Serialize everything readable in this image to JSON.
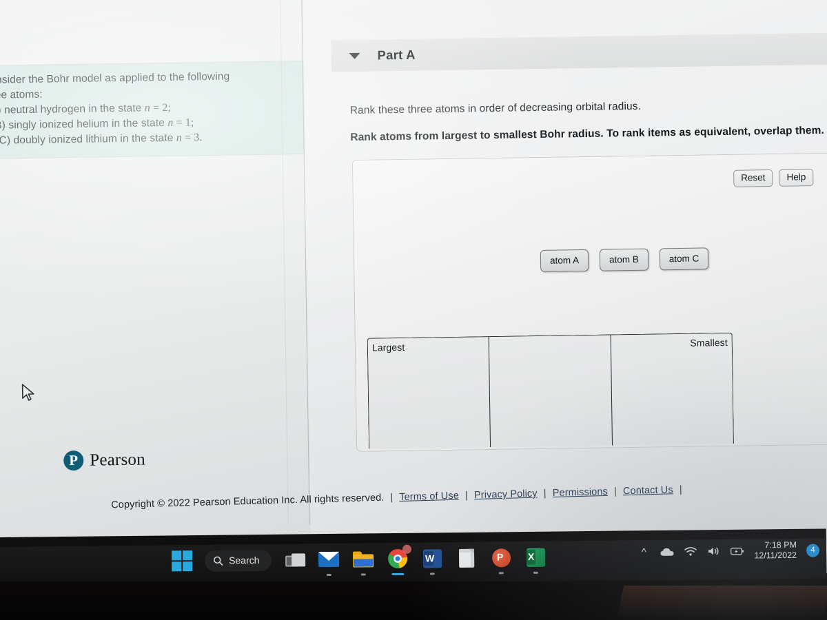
{
  "problem": {
    "line1": "Consider the Bohr model as applied to the following",
    "line2": "three atoms:",
    "itemA_pre": "(A) neutral hydrogen in the state ",
    "itemA_var": "n",
    "itemA_eq": " = ",
    "itemA_val": "2;",
    "itemB_pre": "(B) singly ionized helium in the state ",
    "itemB_var": "n",
    "itemB_eq": " = ",
    "itemB_val": "1;",
    "itemC_pre": "(C) doubly ionized lithium in the state ",
    "itemC_var": "n",
    "itemC_eq": " = ",
    "itemC_val": "3."
  },
  "part": {
    "title": "Part A",
    "caret_icon": "caret-down-icon",
    "question": "Rank these three atoms in order of decreasing orbital radius.",
    "instruction": "Rank atoms from largest to smallest Bohr radius. To rank items as equivalent, overlap them."
  },
  "answer_area": {
    "reset_label": "Reset",
    "help_label": "Help",
    "tiles": [
      {
        "label": "atom A"
      },
      {
        "label": "atom B"
      },
      {
        "label": "atom C"
      }
    ],
    "bins": [
      {
        "label": "Largest",
        "align": "left"
      },
      {
        "label": "",
        "align": "left"
      },
      {
        "label": "Smallest",
        "align": "right"
      }
    ]
  },
  "footer": {
    "logo_mark": "P",
    "logo_word": "Pearson",
    "logo_color": "#115d76",
    "copyright": "Copyright © 2022 Pearson Education Inc. All rights reserved.",
    "separator": "|",
    "links": [
      {
        "label": "Terms of Use"
      },
      {
        "label": "Privacy Policy"
      },
      {
        "label": "Permissions"
      },
      {
        "label": "Contact Us"
      }
    ]
  },
  "scrollbar": {
    "down_arrow_icon": "chevron-down-icon"
  },
  "cursor": {
    "icon": "mouse-pointer-icon"
  },
  "taskbar": {
    "start_icon": "windows-logo-icon",
    "search": {
      "icon": "search-icon",
      "label": "Search"
    },
    "items": [
      {
        "name": "task-view-icon",
        "label": "Task View",
        "running": false
      },
      {
        "name": "mail-icon",
        "label": "Mail",
        "running": true
      },
      {
        "name": "file-explorer-icon",
        "label": "File Explorer",
        "running": true
      },
      {
        "name": "chrome-icon",
        "label": "Google Chrome",
        "running": true
      },
      {
        "name": "word-icon",
        "label": "Microsoft Word",
        "running": true
      },
      {
        "name": "document-icon",
        "label": "Document",
        "running": false
      },
      {
        "name": "powerpoint-icon",
        "label": "Microsoft PowerPoint",
        "running": true
      },
      {
        "name": "excel-icon",
        "label": "Microsoft Excel",
        "running": true
      }
    ],
    "tray": {
      "overflow_icon": "chevron-up-icon",
      "cloud_icon": "cloud-icon",
      "wifi_icon": "wifi-icon",
      "volume_icon": "speaker-icon",
      "battery_icon": "battery-charging-icon",
      "time": "7:18 PM",
      "date": "12/11/2022",
      "notification_count": "4"
    }
  }
}
